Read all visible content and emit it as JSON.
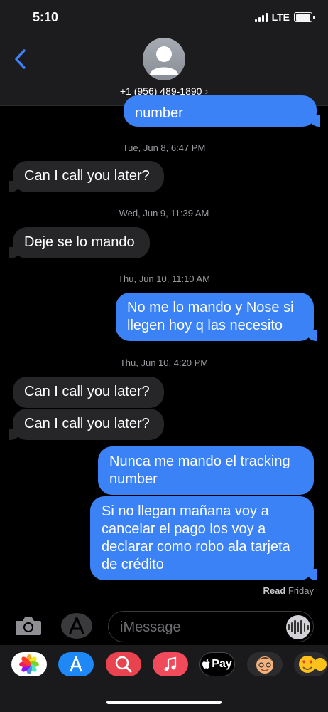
{
  "status_bar": {
    "time": "5:10",
    "network": "LTE"
  },
  "header": {
    "contact": "+1 (956) 489-1890",
    "chevron": "›"
  },
  "messages": {
    "m0": "number",
    "ts1": "Tue, Jun 8, 6:47 PM",
    "m1": "Can I call you later?",
    "ts2": "Wed, Jun 9, 11:39 AM",
    "m2": "Deje se lo mando",
    "ts3": "Thu, Jun 10, 11:10 AM",
    "m3": "No me lo mando y Nose si llegen hoy q las necesito",
    "ts4": "Thu, Jun 10, 4:20 PM",
    "m4": "Can I call you later?",
    "m5": "Can I call you later?",
    "m6": "Nunca me mando el tracking number",
    "m7": "Si no llegan mañana voy a cancelar el pago los voy a declarar como robo ala tarjeta de crédito"
  },
  "receipt": {
    "label": "Read",
    "day": "Friday"
  },
  "composer": {
    "placeholder": "iMessage"
  },
  "drawer": {
    "apple_pay_label": "Pay"
  },
  "colors": {
    "outgoing": "#3b82f6",
    "incoming": "#262628",
    "accent": "#3b82f6"
  }
}
